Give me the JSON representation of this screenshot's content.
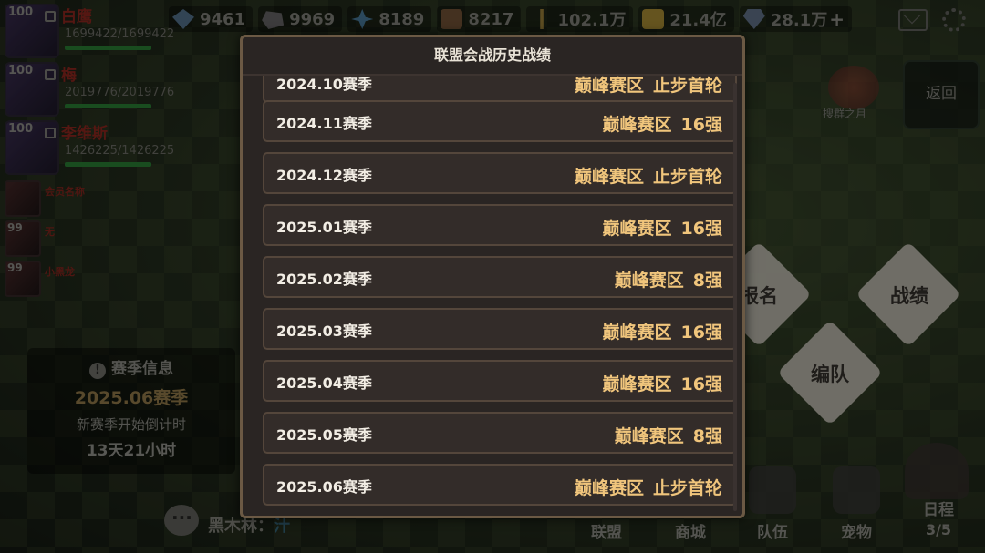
{
  "resources": [
    {
      "icon": "gem-icon",
      "cls": "ic-gem",
      "value": "9461"
    },
    {
      "icon": "ore-icon",
      "cls": "ic-ore",
      "value": "9969"
    },
    {
      "icon": "crystal-icon",
      "cls": "ic-crys",
      "value": "8189"
    },
    {
      "icon": "wood-icon",
      "cls": "ic-wood",
      "value": "8217"
    },
    {
      "icon": "wheat-icon",
      "cls": "ic-wheat",
      "value": "102.1万"
    },
    {
      "icon": "coin-icon",
      "cls": "ic-coin",
      "value": "21.4亿"
    },
    {
      "icon": "diamond-icon",
      "cls": "ic-dia",
      "value": "28.1万"
    }
  ],
  "members": [
    {
      "level": "100",
      "name": "白鹰",
      "hp": "1699422/1699422",
      "hp_fraction": 1.0
    },
    {
      "level": "100",
      "name": "梅",
      "hp": "2019776/2019776",
      "hp_fraction": 1.0
    },
    {
      "level": "100",
      "name": "李维斯",
      "hp": "1426225/1426225",
      "hp_fraction": 1.0
    }
  ],
  "mini_members": [
    {
      "level": "",
      "name": "会员名称"
    },
    {
      "level": "99",
      "name": "无"
    },
    {
      "level": "99",
      "name": "小黑龙"
    }
  ],
  "season_info": {
    "title": "赛季信息",
    "current": "2025.06赛季",
    "countdown_label": "新赛季开始倒计时",
    "countdown": "13天21小时"
  },
  "actions": {
    "signup": "报名",
    "record": "战绩",
    "formation": "编队",
    "back": "返回",
    "battle_label": "搜群之月"
  },
  "chat": {
    "sender": "黑木林",
    "message": "汁"
  },
  "nav": {
    "alliance": "联盟",
    "shop": "商城",
    "team": "队伍",
    "pet": "宠物",
    "schedule": "日程",
    "schedule_progress": "3/5"
  },
  "modal": {
    "title": "联盟会战历史战绩",
    "partial_row": {
      "season": "2024.10赛季",
      "zone": "巅峰赛区",
      "result": "止步首轮"
    },
    "records": [
      {
        "season": "2024.11赛季",
        "zone": "巅峰赛区",
        "result": "16强"
      },
      {
        "season": "2024.12赛季",
        "zone": "巅峰赛区",
        "result": "止步首轮"
      },
      {
        "season": "2025.01赛季",
        "zone": "巅峰赛区",
        "result": "16强"
      },
      {
        "season": "2025.02赛季",
        "zone": "巅峰赛区",
        "result": "8强"
      },
      {
        "season": "2025.03赛季",
        "zone": "巅峰赛区",
        "result": "16强"
      },
      {
        "season": "2025.04赛季",
        "zone": "巅峰赛区",
        "result": "16强"
      },
      {
        "season": "2025.05赛季",
        "zone": "巅峰赛区",
        "result": "8强"
      },
      {
        "season": "2025.06赛季",
        "zone": "巅峰赛区",
        "result": "止步首轮"
      }
    ]
  }
}
